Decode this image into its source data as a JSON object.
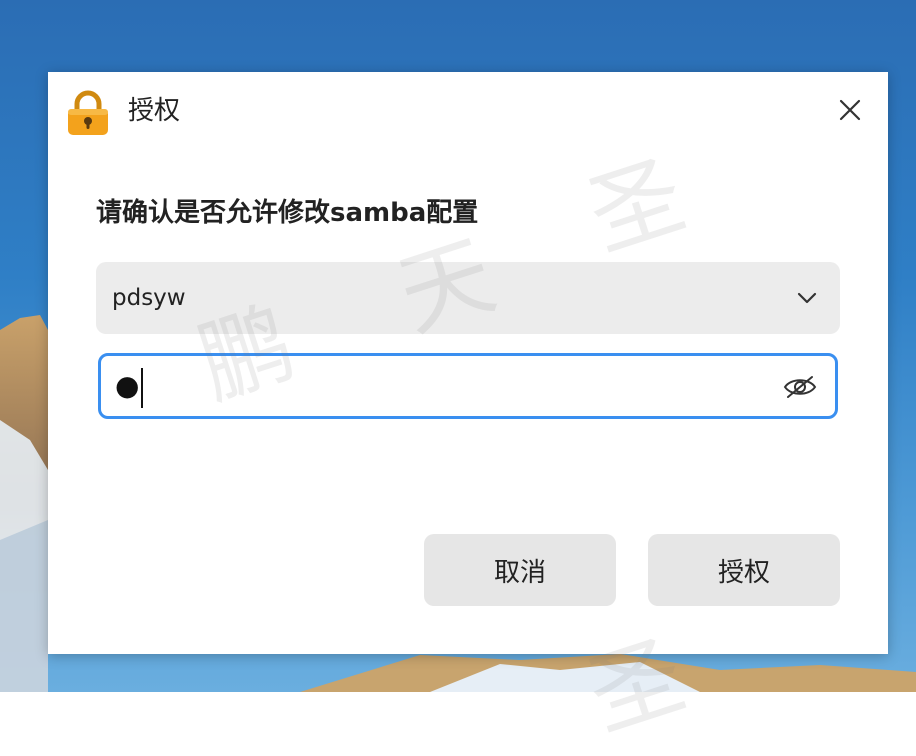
{
  "dialog": {
    "title": "授权",
    "prompt": "请确认是否允许修改samba配置",
    "user_select": {
      "value": "pdsyw"
    },
    "password": {
      "masked_value": "●"
    },
    "buttons": {
      "cancel": "取消",
      "authorize": "授权"
    }
  },
  "watermark": {
    "chars": [
      "鹏",
      "天",
      "圣",
      "圣"
    ]
  },
  "icons": {
    "lock": "lock-icon",
    "close": "close-icon",
    "chevron": "chevron-down-icon",
    "eye": "eye-hidden-icon"
  },
  "colors": {
    "focus_border": "#3a8ff0",
    "lock_body": "#f3a21c",
    "button_bg": "#e6e6e6"
  }
}
